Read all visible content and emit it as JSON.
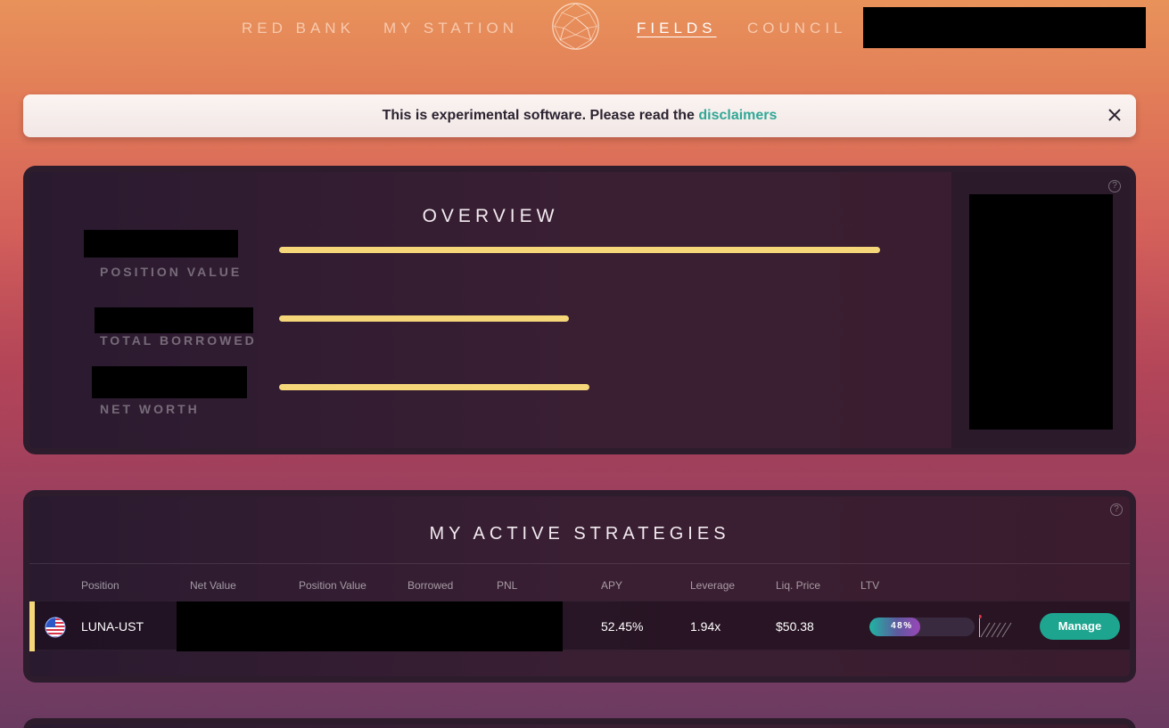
{
  "nav": {
    "links": [
      "RED BANK",
      "MY STATION",
      "FIELDS",
      "COUNCIL"
    ],
    "active": "FIELDS"
  },
  "banner": {
    "text": "This is experimental software. Please read the ",
    "link": "disclaimers"
  },
  "overview": {
    "title": "OVERVIEW",
    "metrics": [
      {
        "label": "POSITION VALUE",
        "fill": 1.0
      },
      {
        "label": "TOTAL BORROWED",
        "fill": 0.482
      },
      {
        "label": "NET WORTH",
        "fill": 0.516
      }
    ]
  },
  "strategies": {
    "title": "MY ACTIVE STRATEGIES",
    "columns": [
      "Position",
      "Net Value",
      "Position Value",
      "Borrowed",
      "PNL",
      "APY",
      "Leverage",
      "Liq. Price",
      "LTV"
    ],
    "rows": [
      {
        "position": "LUNA-UST",
        "apy": "52.45%",
        "leverage": "1.94x",
        "liq_price": "$50.38",
        "ltv": "48%",
        "ltv_fraction": 0.48,
        "action": "Manage"
      }
    ]
  },
  "colors": {
    "accent": "#f5d77a",
    "teal": "#1da58f",
    "link": "#2fa896"
  },
  "icons": [
    "planet-logo-icon",
    "close-icon",
    "help-icon",
    "us-flag-icon"
  ]
}
